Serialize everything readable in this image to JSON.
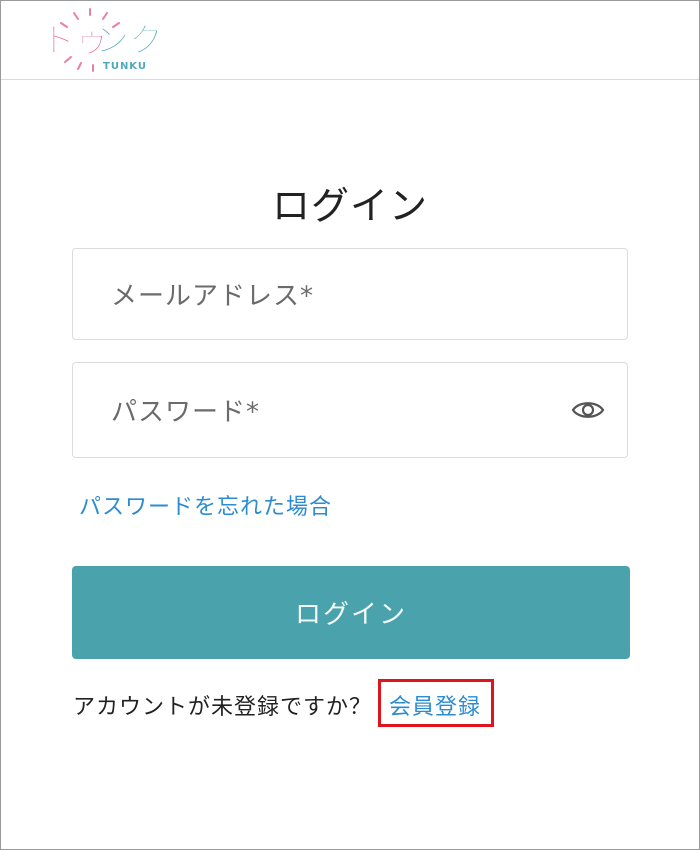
{
  "header": {
    "logo_text": "トゥンク",
    "logo_sub": "TUNKU"
  },
  "login": {
    "title": "ログイン",
    "email_placeholder": "メールアドレス*",
    "password_placeholder": "パスワード*",
    "forgot_label": "パスワードを忘れた場合",
    "submit_label": "ログイン"
  },
  "signup": {
    "prompt": "アカウントが未登録ですか？",
    "link_label": "会員登録"
  },
  "colors": {
    "accent": "#4aa3ac",
    "link": "#2d8ccf",
    "highlight": "#e0141e",
    "logo_pink": "#e8689a",
    "logo_teal": "#4fa9b8"
  },
  "icons": {
    "password_toggle": "eye-icon"
  }
}
